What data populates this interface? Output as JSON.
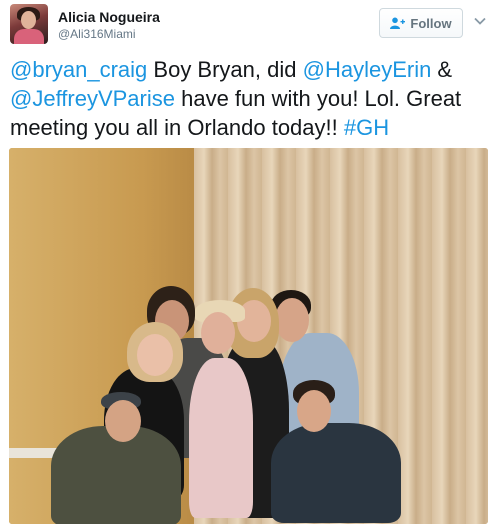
{
  "tweet": {
    "author_name": "Alicia Nogueira",
    "author_handle": "@Ali316Miami",
    "follow_label": "Follow",
    "text_parts": [
      {
        "text": "@bryan_craig",
        "link": true
      },
      {
        "text": " Boy Bryan, did ",
        "link": false
      },
      {
        "text": "@HayleyErin",
        "link": true
      },
      {
        "text": " & ",
        "link": false
      },
      {
        "text": "@JeffreyVParise",
        "link": true
      },
      {
        "text": " have fun with you! Lol. Great meeting you all in Orlando today!! ",
        "link": false
      },
      {
        "text": "#GH",
        "link": true
      }
    ]
  },
  "icons": {
    "follow": "add-user-icon",
    "menu": "chevron-down-icon",
    "avatar": "profile-photo"
  },
  "colors": {
    "link": "#1b95e0",
    "text": "#14171a",
    "muted": "#657786"
  }
}
